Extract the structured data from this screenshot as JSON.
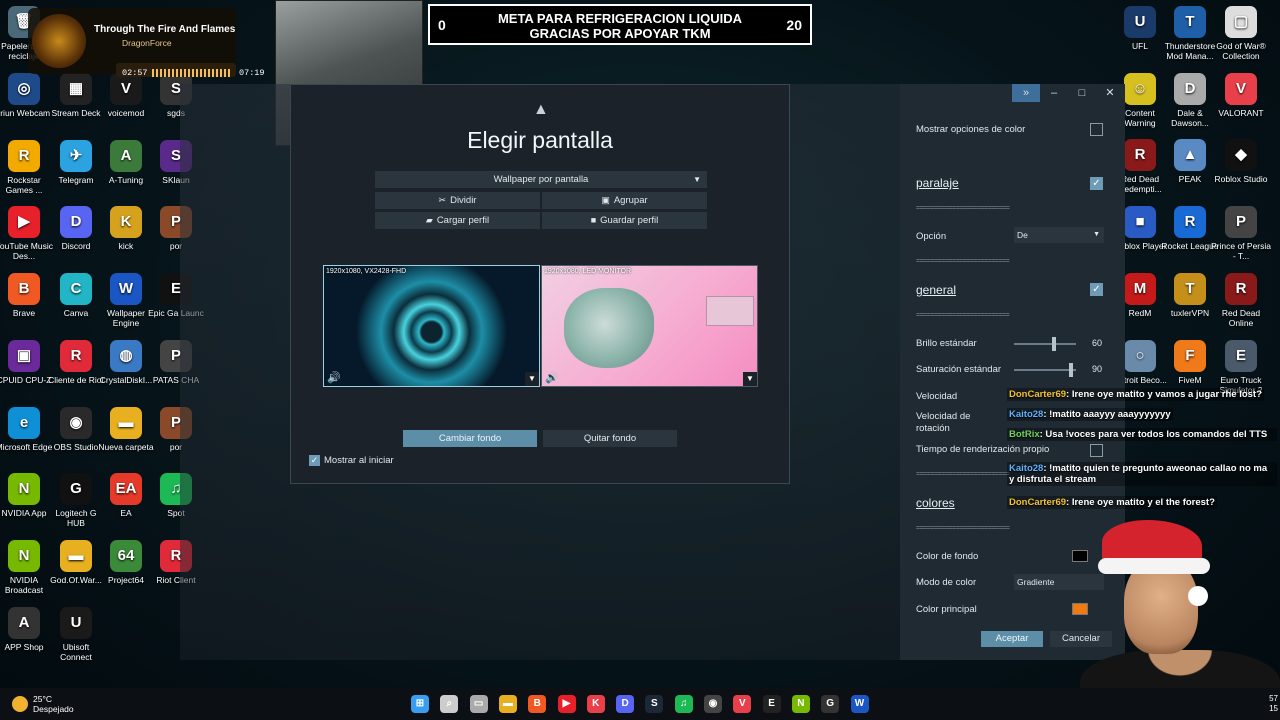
{
  "desktop_left": [
    {
      "label": "Papelera de reciclaje",
      "color": "#4a6a7a",
      "glyph": "🗑"
    },
    {
      "label": "Iriun Webcam",
      "color": "#1e4a8a",
      "glyph": "◎"
    },
    {
      "label": "Stream Deck",
      "color": "#222",
      "glyph": "▦"
    },
    {
      "label": "voicemod",
      "color": "#1a1a1a",
      "glyph": "V"
    },
    {
      "label": "sgds",
      "color": "#333",
      "glyph": "S"
    },
    {
      "label": "Rockstar Games ...",
      "color": "#f2a900",
      "glyph": "R"
    },
    {
      "label": "Telegram",
      "color": "#2aa3e0",
      "glyph": "✈"
    },
    {
      "label": "A-Tuning",
      "color": "#3b7a3b",
      "glyph": "A"
    },
    {
      "label": "SKlaun",
      "color": "#5a2a8a",
      "glyph": "S"
    },
    {
      "label": "YouTube Music Des...",
      "color": "#e8202a",
      "glyph": "▶"
    },
    {
      "label": "Discord",
      "color": "#5865f2",
      "glyph": "D"
    },
    {
      "label": "kick",
      "color": "#d6a21e",
      "glyph": "K"
    },
    {
      "label": "por",
      "color": "#8a4a2a",
      "glyph": "P"
    },
    {
      "label": "Brave",
      "color": "#f05a22",
      "glyph": "B"
    },
    {
      "label": "Canva",
      "color": "#21b5c6",
      "glyph": "C"
    },
    {
      "label": "Wallpaper Engine",
      "color": "#1a56c4",
      "glyph": "W"
    },
    {
      "label": "Epic Ga Launc",
      "color": "#111",
      "glyph": "E"
    },
    {
      "label": "CPUID CPU-Z",
      "color": "#6a2a9a",
      "glyph": "▣"
    },
    {
      "label": "Cliente de Riot",
      "color": "#e02a3a",
      "glyph": "R"
    },
    {
      "label": "CrystalDiskI...",
      "color": "#3a7ac4",
      "glyph": "◍"
    },
    {
      "label": "PATAS CHA",
      "color": "#444",
      "glyph": "P"
    },
    {
      "label": "Microsoft Edge",
      "color": "#0f8fd6",
      "glyph": "e"
    },
    {
      "label": "OBS Studio",
      "color": "#2a2a2a",
      "glyph": "◉"
    },
    {
      "label": "Nueva carpeta",
      "color": "#e8b020",
      "glyph": "▬"
    },
    {
      "label": "por",
      "color": "#8a4a2a",
      "glyph": "P"
    },
    {
      "label": "NVIDIA App",
      "color": "#76b900",
      "glyph": "N"
    },
    {
      "label": "Logitech G HUB",
      "color": "#111",
      "glyph": "G"
    },
    {
      "label": "EA",
      "color": "#e53a2a",
      "glyph": "EA"
    },
    {
      "label": "Spot",
      "color": "#1db954",
      "glyph": "♫"
    },
    {
      "label": "NVIDIA Broadcast",
      "color": "#76b900",
      "glyph": "N"
    },
    {
      "label": "God.Of.War...",
      "color": "#e8b020",
      "glyph": "▬"
    },
    {
      "label": "Project64",
      "color": "#3a8a3a",
      "glyph": "64"
    },
    {
      "label": "Riot Client",
      "color": "#e02a3a",
      "glyph": "R"
    },
    {
      "label": "APP Shop",
      "color": "#333",
      "glyph": "A"
    },
    {
      "label": "Ubisoft Connect",
      "color": "#1a1a1a",
      "glyph": "U"
    }
  ],
  "desktop_right": [
    {
      "label": "UFL",
      "color": "#1a3a6a",
      "glyph": "U"
    },
    {
      "label": "Thunderstore Mod Mana...",
      "color": "#1e5fa8",
      "glyph": "T"
    },
    {
      "label": "God of War® Collection",
      "color": "#ddd",
      "glyph": "▢"
    },
    {
      "label": "Content Warning",
      "color": "#d6c020",
      "glyph": "☺"
    },
    {
      "label": "Dale & Dawson...",
      "color": "#aaa",
      "glyph": "D"
    },
    {
      "label": "VALORANT",
      "color": "#e8404a",
      "glyph": "V"
    },
    {
      "label": "Red Dead Redempti...",
      "color": "#8a1a1a",
      "glyph": "R"
    },
    {
      "label": "PEAK",
      "color": "#5a8ac4",
      "glyph": "▲"
    },
    {
      "label": "Roblox Studio",
      "color": "#111",
      "glyph": "◆"
    },
    {
      "label": "Roblox Player",
      "color": "#2a5ac4",
      "glyph": "■"
    },
    {
      "label": "Rocket League",
      "color": "#1a6ad6",
      "glyph": "R"
    },
    {
      "label": "Prince of Persia - T...",
      "color": "#444",
      "glyph": "P"
    },
    {
      "label": "RedM",
      "color": "#c41a1a",
      "glyph": "M"
    },
    {
      "label": "tuxlerVPN",
      "color": "#c4901a",
      "glyph": "T"
    },
    {
      "label": "Red Dead Online",
      "color": "#8a1a1a",
      "glyph": "R"
    },
    {
      "label": "Detroit Beco...",
      "color": "#6a8aaa",
      "glyph": "○"
    },
    {
      "label": "FiveM",
      "color": "#f07a1a",
      "glyph": "F"
    },
    {
      "label": "Euro Truck Simulator 2",
      "color": "#4a5a6a",
      "glyph": "E"
    }
  ],
  "music": {
    "title": "Through The Fire And Flames",
    "artist": "DragonForce",
    "elapsed": "02:57",
    "total": "07:19"
  },
  "goal": {
    "start": "0",
    "title": "META PARA REFRIGERACION LIQUIDA GRACIAS POR APOYAR TKM",
    "end": "20"
  },
  "dialog": {
    "collapse": "▲",
    "title": "Elegir pantalla",
    "mode_select": "Wallpaper por pantalla",
    "split": "Dividir",
    "group": "Agrupar",
    "load_profile": "Cargar perfil",
    "save_profile": "Guardar perfil",
    "monitors": [
      {
        "label": "1920x1080, VX2428-FHD"
      },
      {
        "label": "1920x1080, LED MONITOR"
      }
    ],
    "change_bg": "Cambiar fondo",
    "remove_bg": "Quitar fondo",
    "show_on_start": "Mostrar al iniciar"
  },
  "panel": {
    "show_color_options": "Mostrar opciones de color",
    "parallax": "paralaje",
    "option_label": "Opción",
    "option_value": "De",
    "general": "general",
    "brightness_label": "Brillo estándar",
    "brightness_value": "60",
    "brightness": 0.65,
    "saturation_label": "Saturación estándar",
    "saturation_value": "90",
    "saturation": 0.95,
    "speed": "Velocidad",
    "rotation_speed": "Velocidad de rotación",
    "render_time": "Tiempo de renderización propio",
    "colors": "colores",
    "bg_color": "Color de fondo",
    "bg_color_value": "#000000",
    "color_mode": "Modo de color",
    "color_mode_value": "Gradiente",
    "primary_color": "Color principal",
    "primary_color_value": "#f07a10",
    "accept": "Aceptar",
    "cancel": "Cancelar"
  },
  "chat": [
    {
      "user": "DonCarter69",
      "msg": ": Irene oye matito y vamos a jugar rhe lost?",
      "cls": "u1"
    },
    {
      "user": "Kaito28",
      "msg": ": !matito aaayyy aaayyyyyyy",
      "cls": "u2"
    },
    {
      "user": "BotRix",
      "msg": ": Usa !voces para ver todos los comandos del TTS",
      "cls": "u3"
    },
    {
      "user": "Kaito28",
      "msg": ": !matito quien te pregunto aweonao callao no ma y disfruta el stream",
      "cls": "u2"
    },
    {
      "user": "DonCarter69",
      "msg": ": Irene oye matito y el the forest?",
      "cls": "u1"
    }
  ],
  "taskbar": {
    "temp": "25°C",
    "weather": "Despejado",
    "apps": [
      "windows",
      "search",
      "task-view",
      "files",
      "brave",
      "youtube-music",
      "kick",
      "discord",
      "steam",
      "spotify",
      "obs",
      "valorant",
      "epic",
      "nvidia",
      "logitech",
      "wallpaper-engine"
    ],
    "time": "57",
    "date": "15"
  }
}
